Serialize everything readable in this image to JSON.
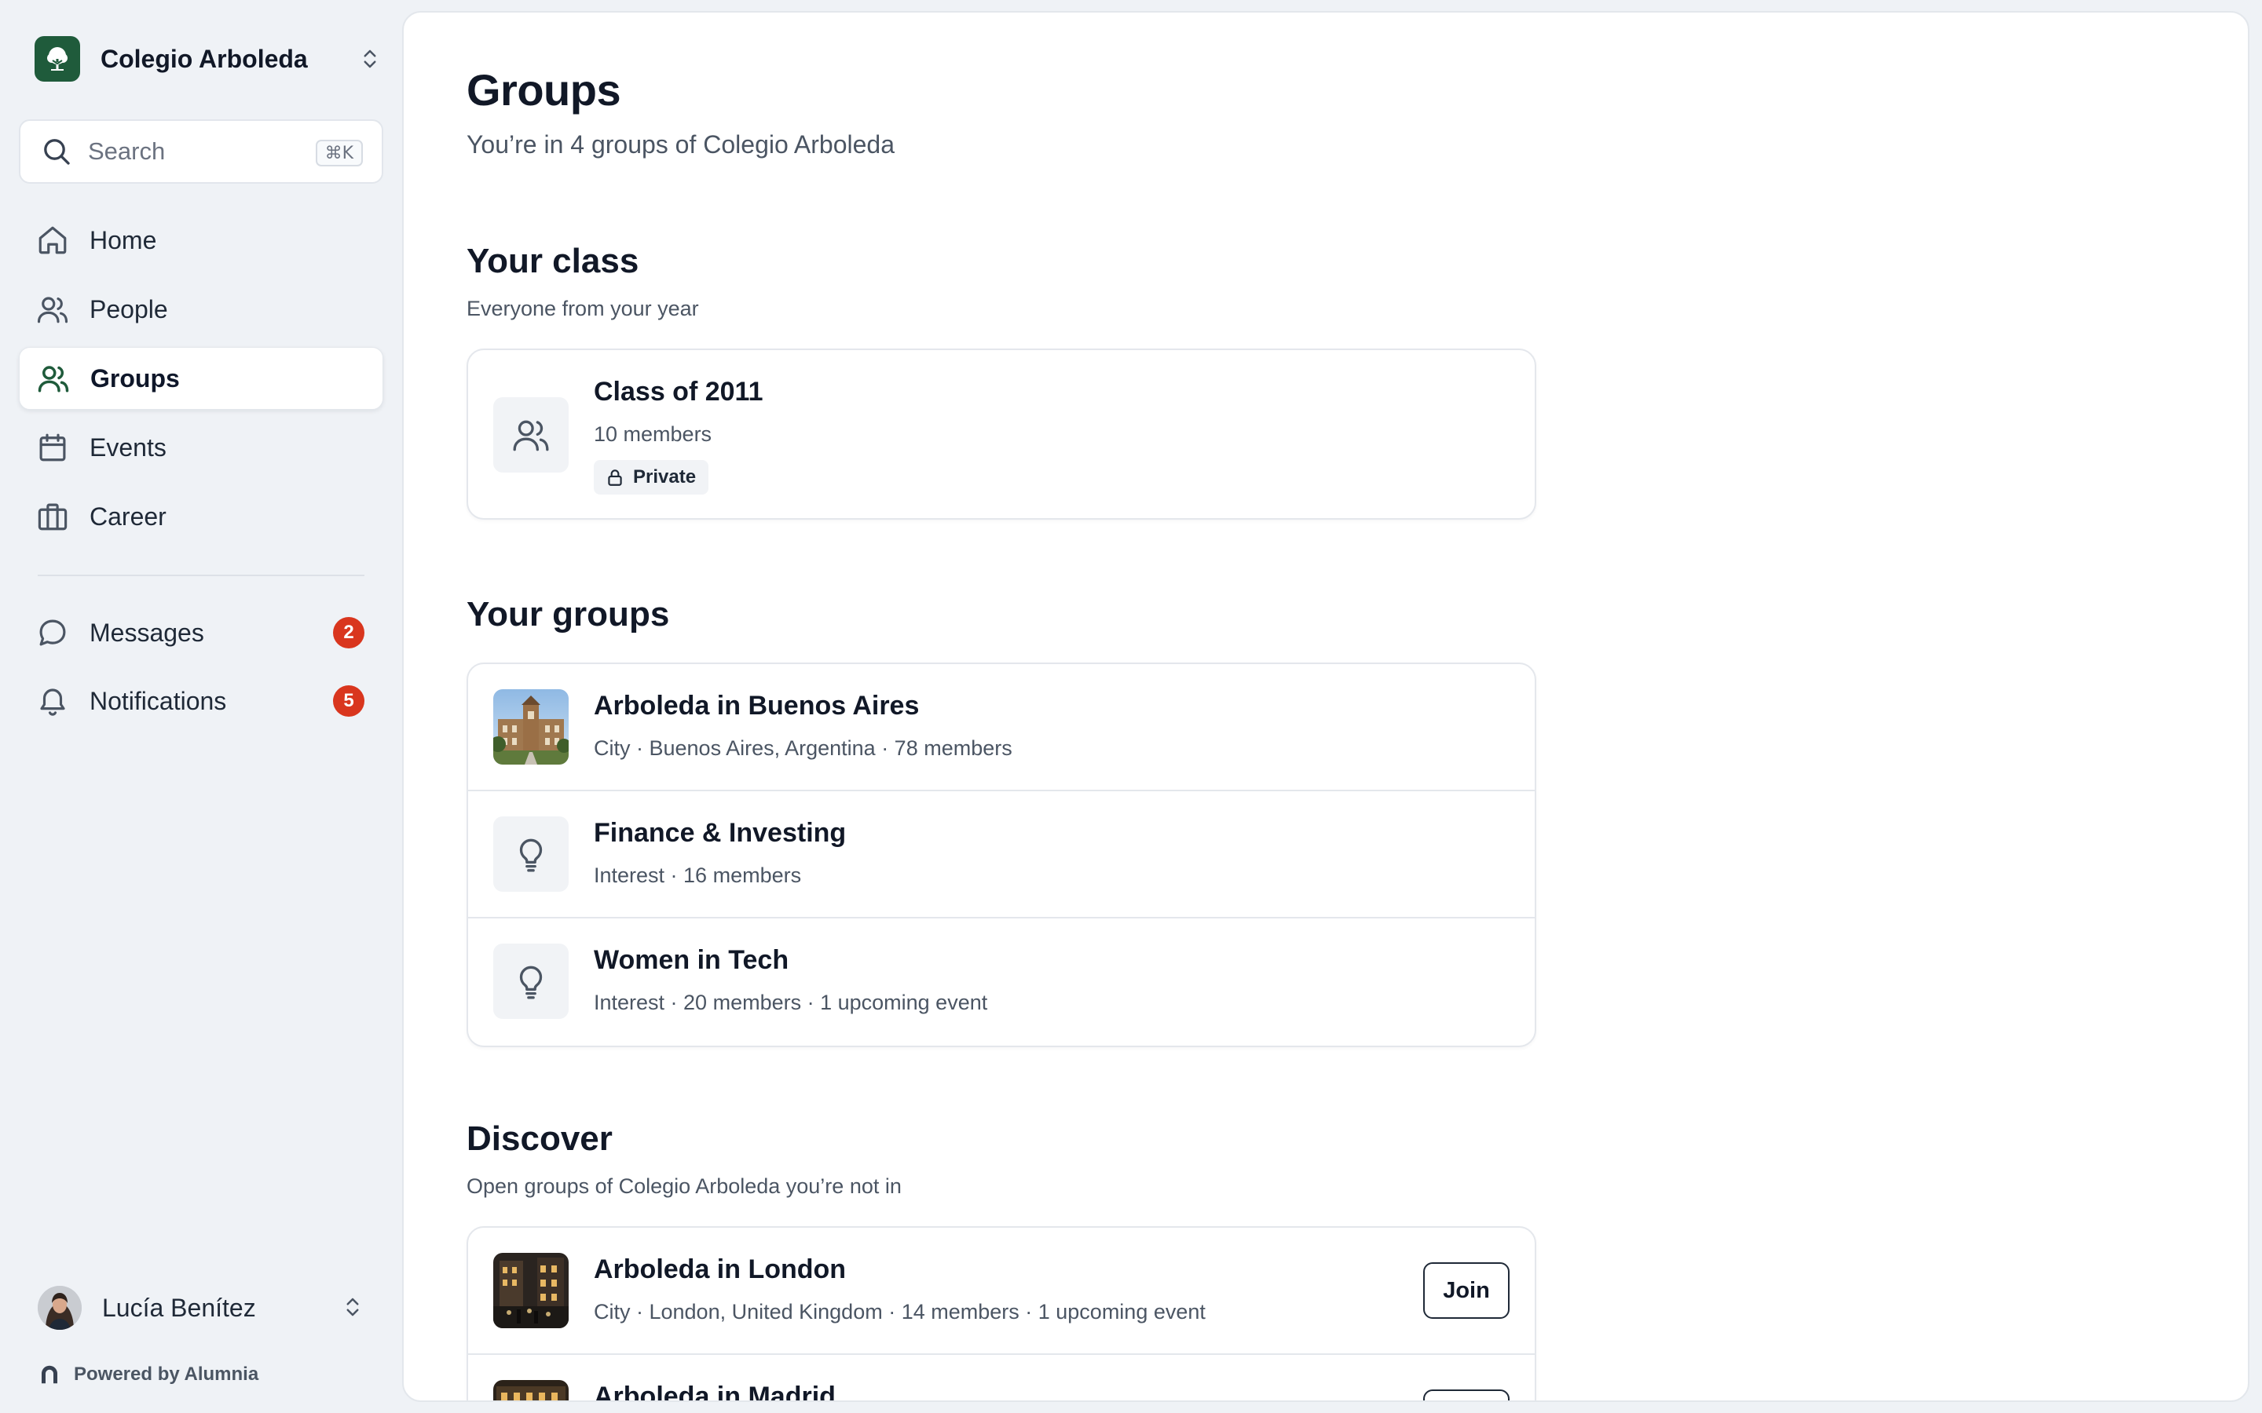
{
  "org": {
    "name": "Colegio Arboleda"
  },
  "search": {
    "placeholder": "Search",
    "shortcut": "⌘K"
  },
  "nav": {
    "home": "Home",
    "people": "People",
    "groups": "Groups",
    "events": "Events",
    "career": "Career",
    "messages": {
      "label": "Messages",
      "badge": "2"
    },
    "notifications": {
      "label": "Notifications",
      "badge": "5"
    }
  },
  "user": {
    "name": "Lucía Benítez"
  },
  "footer": {
    "powered_by": "Powered by Alumnia"
  },
  "page": {
    "title": "Groups",
    "subtitle": "You’re in 4 groups of Colegio Arboleda"
  },
  "your_class": {
    "title": "Your class",
    "subtitle": "Everyone from your year",
    "group": {
      "name": "Class of 2011",
      "meta": "10 members",
      "privacy": "Private"
    }
  },
  "your_groups": {
    "title": "Your groups",
    "items": [
      {
        "name": "Arboleda in Buenos Aires",
        "meta": "City · Buenos Aires, Argentina · 78 members",
        "icon": "building-photo"
      },
      {
        "name": "Finance & Investing",
        "meta": "Interest · 16 members",
        "icon": "lightbulb-icon"
      },
      {
        "name": "Women in Tech",
        "meta": "Interest · 20 members · 1 upcoming event",
        "icon": "lightbulb-icon"
      }
    ]
  },
  "discover": {
    "title": "Discover",
    "subtitle": "Open groups of Colegio Arboleda you’re not in",
    "join_label": "Join",
    "items": [
      {
        "name": "Arboleda in London",
        "meta": "City · London, United Kingdom · 14 members · 1 upcoming event",
        "icon": "city-photo"
      },
      {
        "name": "Arboleda in Madrid",
        "meta": "",
        "icon": "city-photo"
      }
    ]
  },
  "colors": {
    "brand": "#1f5b3b",
    "badge": "#d9361e",
    "background": "#eff2f6"
  }
}
